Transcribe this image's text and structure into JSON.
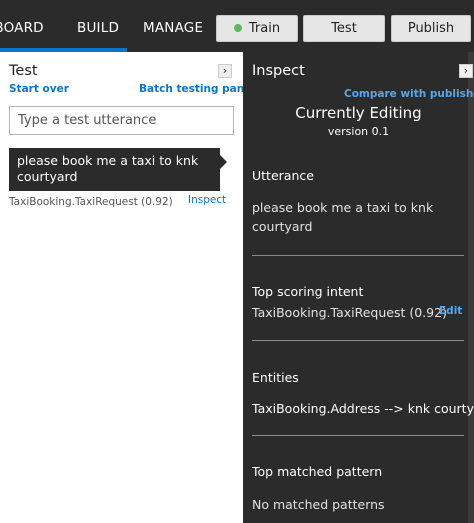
{
  "nav": {
    "tabs": [
      "HBOARD",
      "BUILD",
      "MANAGE"
    ],
    "active": "BUILD"
  },
  "toolbar": {
    "train": "Train",
    "test": "Test",
    "publish": "Publish"
  },
  "test_panel": {
    "title": "Test",
    "start_over": "Start over",
    "batch_testing": "Batch testing panel",
    "input_placeholder": "Type a test utterance",
    "result": {
      "utterance": "please book me a taxi to knk courtyard",
      "intent": "TaxiBooking.TaxiRequest (0.92)",
      "inspect_label": "Inspect"
    }
  },
  "inspect_panel": {
    "title": "Inspect",
    "compare": "Compare with published",
    "currently_editing": "Currently Editing",
    "version": "version 0.1",
    "utterance_head": "Utterance",
    "utterance_text": "please book me a taxi to knk courtyard",
    "top_intent_head": "Top scoring intent",
    "top_intent_text": "TaxiBooking.TaxiRequest (0.92)",
    "edit_label": "Edit",
    "entities_head": "Entities",
    "entities_text": "TaxiBooking.Address --> knk courtyard",
    "pattern_head": "Top matched pattern",
    "pattern_text": "No matched patterns"
  },
  "colors": {
    "accent": "#0b75c9",
    "dark_bg": "#2b2b2b",
    "train_status": "#5cb85c"
  },
  "icons": {
    "collapse": "chevron-right-icon",
    "train_status": "status-dot-icon"
  }
}
